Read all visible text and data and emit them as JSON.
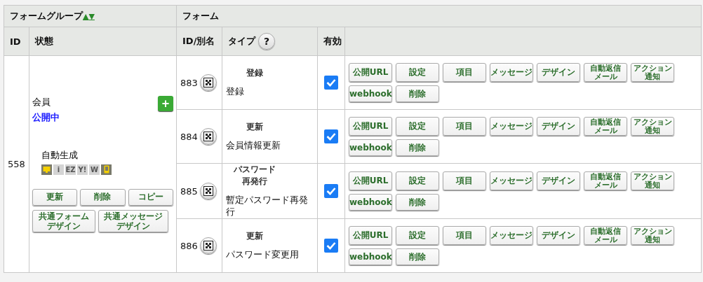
{
  "header": {
    "group_title": "フォームグループ",
    "sort_up": "▲",
    "sort_down": "▼",
    "form_title": "フォーム",
    "columns": [
      {
        "label": "ID"
      },
      {
        "label": "状態"
      },
      {
        "label": "ID/別名"
      },
      {
        "label": "タイプ",
        "help": "?"
      },
      {
        "label": "有効"
      }
    ]
  },
  "group": {
    "id": "558",
    "name": "会員",
    "status": "公開中",
    "add": "+",
    "auto_label": "自動生成",
    "devices": [
      {
        "kind": "pc",
        "on": true
      },
      {
        "kind": "text",
        "label": "i",
        "on": false
      },
      {
        "kind": "text",
        "label": "EZ",
        "on": false
      },
      {
        "kind": "text",
        "label": "Y!",
        "on": false
      },
      {
        "kind": "text",
        "label": "W",
        "on": false
      },
      {
        "kind": "phone",
        "on": true
      }
    ],
    "buttons": [
      "更新",
      "削除",
      "コピー"
    ],
    "design_buttons": [
      "共通フォームデザイン",
      "共通メッセージデザイン"
    ]
  },
  "forms": [
    {
      "id": "883",
      "type": "登録",
      "name": "登録",
      "enabled": true,
      "actions": [
        "公開URL",
        "設定",
        "項目",
        "メッセージ",
        "デザイン",
        "自動返信メール",
        "アクション通知",
        "webhook",
        "削除"
      ]
    },
    {
      "id": "884",
      "type": "更新",
      "name": "会員情報更新",
      "enabled": true,
      "actions": [
        "公開URL",
        "設定",
        "項目",
        "メッセージ",
        "デザイン",
        "自動返信メール",
        "アクション通知",
        "webhook",
        "削除"
      ]
    },
    {
      "id": "885",
      "type": "パスワード再発行",
      "name": "暫定パスワード再発行",
      "enabled": true,
      "actions": [
        "公開URL",
        "設定",
        "項目",
        "メッセージ",
        "デザイン",
        "自動返信メール",
        "アクション通知",
        "webhook",
        "削除"
      ]
    },
    {
      "id": "886",
      "type": "更新",
      "name": "パスワード変更用",
      "enabled": true,
      "actions": [
        "公開URL",
        "設定",
        "項目",
        "メッセージ",
        "デザイン",
        "自動返信メール",
        "アクション通知",
        "webhook",
        "削除"
      ]
    }
  ]
}
